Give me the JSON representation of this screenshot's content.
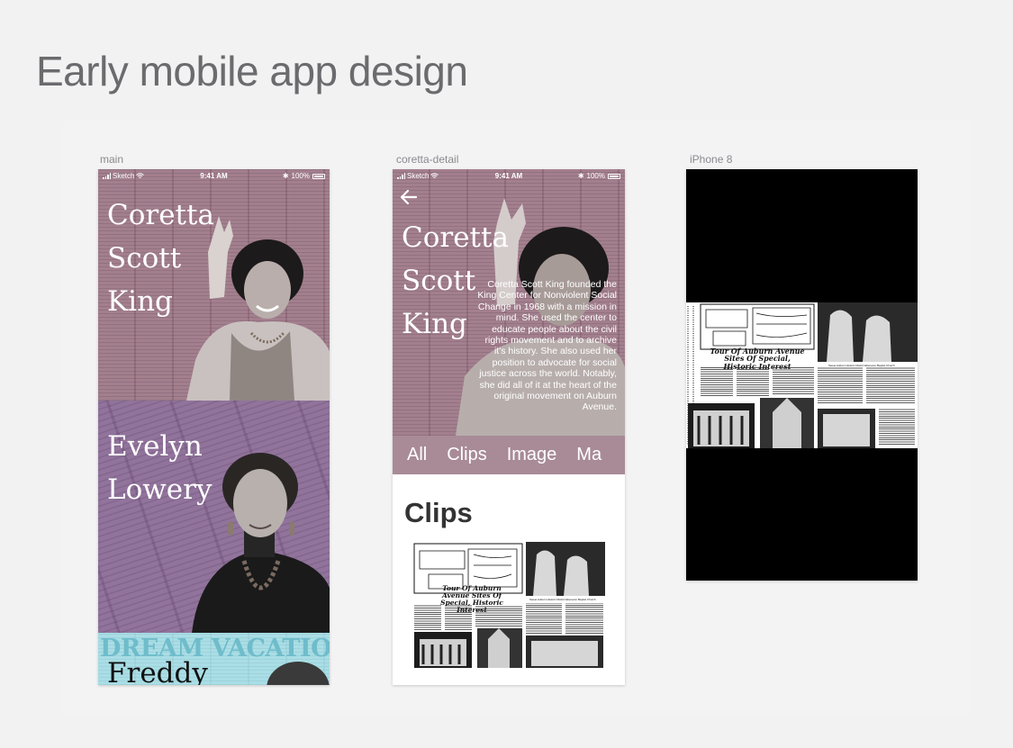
{
  "page": {
    "title": "Early mobile app design"
  },
  "artboards": {
    "main": {
      "label": "main"
    },
    "detail": {
      "label": "coretta-detail"
    },
    "device": {
      "label": "iPhone 8"
    }
  },
  "status_bar": {
    "carrier": "Sketch",
    "time": "9:41 AM",
    "battery": "100%"
  },
  "main": {
    "people": [
      {
        "name_lines": [
          "Coretta",
          "Scott",
          "King"
        ],
        "bg_color": "#9c7585"
      },
      {
        "name_lines": [
          "Evelyn",
          "Lowery"
        ],
        "bg_color": "#8a6a96"
      },
      {
        "name_lines": [
          "Freddy"
        ],
        "bg_color": "#a6dde5",
        "banner": "DREAM VACATIONS"
      }
    ]
  },
  "detail": {
    "name_lines": [
      "Coretta",
      "Scott",
      "King"
    ],
    "bio": "Coretta Scott King founded the King Center for Nonviolent Social Change in 1968 with a mission in mind. She used the center to educate people about the civil rights movement and to archive it's history. She also used her position to advocate for social justice across the world. Notably, she did all of it at the heart of the original movement on Auburn Avenue.",
    "tabs": [
      "All",
      "Clips",
      "Image",
      "Ma"
    ],
    "section_heading": "Clips"
  },
  "clipping": {
    "headline": "Tour Of Auburn Avenue Sites Of Special, Historic Interest",
    "photo_caption": "Sweet Auburn Historic District Ebenezer Baptist Church"
  },
  "colors": {
    "coretta_bg": "#9c7585",
    "evelyn_bg": "#8a6a96",
    "freddy_bg": "#a6dde5",
    "tab_bar": "#a88b97"
  }
}
